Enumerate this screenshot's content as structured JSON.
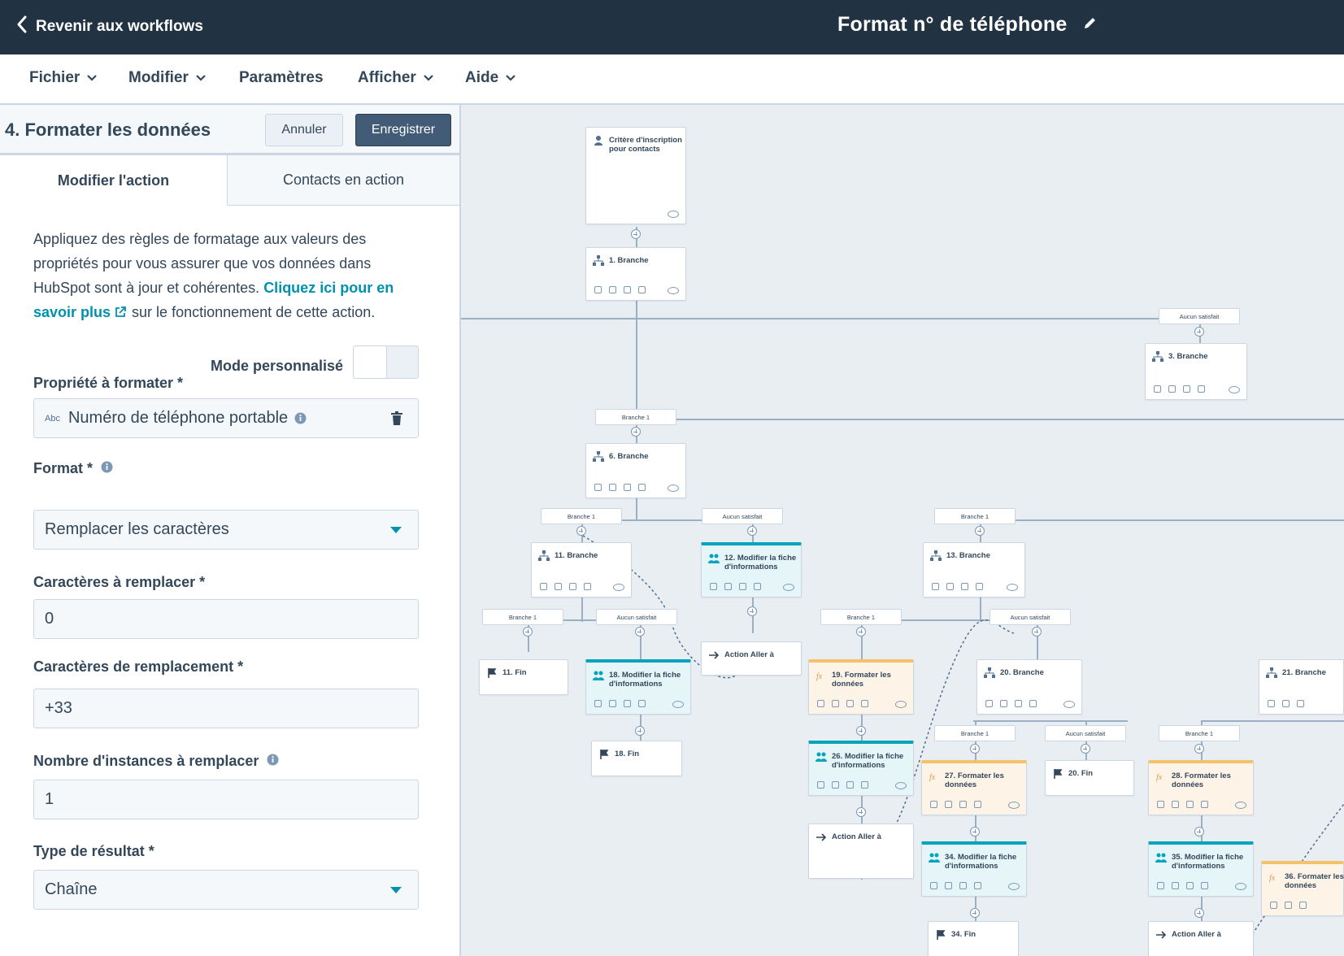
{
  "header": {
    "back_label": "Revenir aux workflows",
    "title": "Format n° de téléphone"
  },
  "menu": {
    "file": "Fichier",
    "edit": "Modifier",
    "settings": "Paramètres",
    "view": "Afficher",
    "help": "Aide"
  },
  "panel": {
    "title": "4. Formater les données",
    "cancel": "Annuler",
    "save": "Enregistrer",
    "tab_edit": "Modifier l'action",
    "tab_contacts": "Contacts en action",
    "description_1": "Appliquez des règles de formatage aux valeurs des propriétés pour vous assurer que vos données dans HubSpot sont à jour et cohérentes. ",
    "description_link": "Cliquez ici pour en savoir plus",
    "description_2": "sur le fonctionnement de cette action.",
    "custom_mode_label": "Mode personnalisé",
    "custom_mode_on": false,
    "property_label": "Propriété à formater *",
    "property_type": "Abc",
    "property_value": "Numéro de téléphone portable",
    "format_label": "Format *",
    "format_value": "Remplacer les caractères",
    "chars_replace_label": "Caractères à remplacer *",
    "chars_replace_value": "0",
    "replacement_label": "Caractères de remplacement *",
    "replacement_value": "+33",
    "instances_label": "Nombre d'instances à remplacer",
    "instances_value": "1",
    "result_label": "Type de résultat *",
    "result_value": "Chaîne"
  },
  "workflow": {
    "trigger": "Critère d'inscription pour contacts",
    "nodes": {
      "n1": "1. Branche",
      "n3": "3. Branche",
      "n6": "6. Branche",
      "n11": "11. Branche",
      "n12": "12. Modifier la fiche d'informations",
      "n13": "13. Branche",
      "goto1": "Action Aller à",
      "end11": "11. Fin",
      "n18": "18. Modifier la fiche d'informations",
      "end18": "18. Fin",
      "n19": "19. Formater les données",
      "n20": "20. Branche",
      "n21": "21. Branche",
      "n26": "26. Modifier la fiche d'informations",
      "goto2": "Action Aller à",
      "n27": "27. Formater les données",
      "end20": "20. Fin",
      "n28": "28. Formater les données",
      "n34": "34. Modifier la fiche d'informations",
      "end34": "34. Fin",
      "n35": "35. Modifier la fiche d'informations",
      "goto3": "Action Aller à",
      "n36": "36. Formater les données"
    },
    "tags": {
      "branch1": "Branche 1",
      "none": "Aucun satisfait"
    }
  }
}
